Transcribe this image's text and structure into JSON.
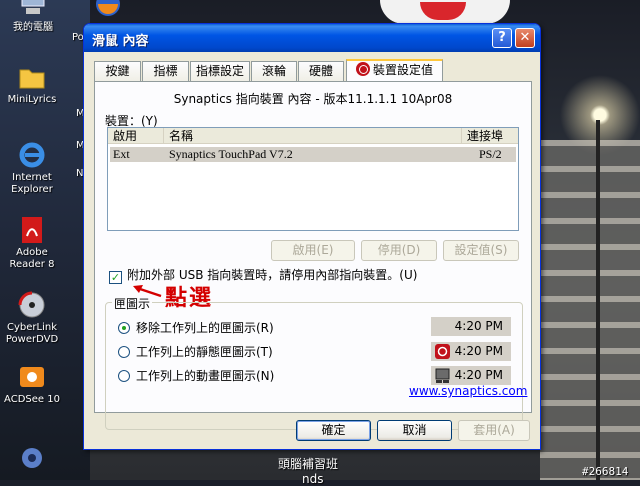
{
  "desktop": {
    "icons": [
      {
        "name": "my-computer",
        "label": "我的電腦"
      },
      {
        "name": "minilyrics",
        "label": "MiniLyrics"
      },
      {
        "name": "internet-explorer",
        "label": "Internet Explorer"
      },
      {
        "name": "adobe-reader",
        "label": "Adobe Reader 8"
      },
      {
        "name": "cyberlink-powerdvd",
        "label": "CyberLink PowerDVD"
      },
      {
        "name": "acdsee",
        "label": "ACDSee 10"
      }
    ],
    "partial_labels": [
      "Po",
      "M",
      "M",
      "N"
    ],
    "taskbar_text": "頭腦補習班",
    "taskbar_subtext": "nds",
    "watermark": "#266814"
  },
  "dialog": {
    "title": "滑鼠 內容",
    "help_glyph": "?",
    "close_glyph": "✕",
    "tabs": [
      {
        "label": "按鍵",
        "active": false
      },
      {
        "label": "指標",
        "active": false
      },
      {
        "label": "指標設定",
        "active": false
      },
      {
        "label": "滾輪",
        "active": false
      },
      {
        "label": "硬體",
        "active": false
      },
      {
        "label": "裝置設定值",
        "active": true
      }
    ],
    "version_text": "Synaptics 指向裝置 內容 - 版本11.1.1.1 10Apr08",
    "devices_label": "裝置：(Y)",
    "list": {
      "columns": [
        "啟用",
        "名稱",
        "連接埠"
      ],
      "rows": [
        {
          "enabled": "Ext",
          "name": "Synaptics TouchPad V7.2",
          "port": "PS/2"
        }
      ]
    },
    "buttons": {
      "enable": "啟用(E)",
      "disable": "停用(D)",
      "settings": "設定值(S)"
    },
    "usb_checkbox": {
      "label": "附加外部 USB 指向裝置時，請停用內部指向裝置。(U)",
      "checked": true
    },
    "annotation": "點選",
    "tray_group": {
      "title": "匣圖示",
      "options": [
        {
          "label": "移除工作列上的匣圖示(R)",
          "selected": true,
          "time": "4:20 PM",
          "icon": "none"
        },
        {
          "label": "工作列上的靜態匣圖示(T)",
          "selected": false,
          "time": "4:20 PM",
          "icon": "synaptics-icon"
        },
        {
          "label": "工作列上的動畫匣圖示(N)",
          "selected": false,
          "time": "4:20 PM",
          "icon": "touchpad-icon"
        }
      ]
    },
    "link": "www.synaptics.com",
    "footer": {
      "ok": "確定",
      "cancel": "取消",
      "apply": "套用(A)"
    }
  },
  "colors": {
    "title_blue": "#0055e5",
    "annotation_red": "#d40000",
    "accent_orange": "#ffc73c",
    "check_green": "#21a121",
    "link_blue": "#0000ff"
  }
}
